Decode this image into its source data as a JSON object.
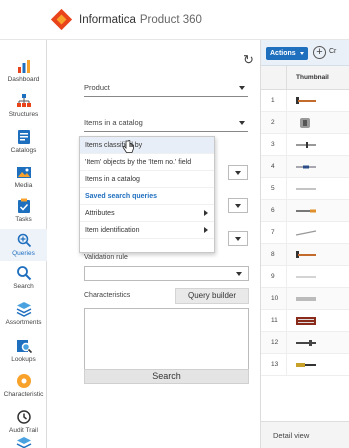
{
  "header": {
    "brand": "Informatica",
    "product": "Product 360"
  },
  "sidebar": {
    "items": [
      {
        "label": "Dashboard",
        "icon": "dashboard-icon"
      },
      {
        "label": "Structures",
        "icon": "structures-icon"
      },
      {
        "label": "Catalogs",
        "icon": "catalogs-icon"
      },
      {
        "label": "Media",
        "icon": "media-icon"
      },
      {
        "label": "Tasks",
        "icon": "tasks-icon"
      },
      {
        "label": "Queries",
        "icon": "queries-icon",
        "active": true
      },
      {
        "label": "Search",
        "icon": "search-icon"
      },
      {
        "label": "Assortments",
        "icon": "assortments-icon"
      },
      {
        "label": "Lookups",
        "icon": "lookups-icon"
      },
      {
        "label": "Characteristic",
        "icon": "characteristic-icon"
      },
      {
        "label": "Audit Trail",
        "icon": "audit-trail-icon"
      }
    ]
  },
  "filters": {
    "product_select": "Product",
    "catalog_select": "Items in a catalog",
    "validation_rule_label": "Validation rule",
    "characteristics_label": "Characteristics",
    "query_builder_button": "Query builder",
    "search_button": "Search"
  },
  "menu": {
    "items": [
      {
        "label": "Items classified by",
        "hover": true
      },
      {
        "label": "'Item' objects by the 'Item no.' field"
      },
      {
        "label": "Items in a catalog"
      },
      {
        "label": "Saved search queries",
        "section": true
      },
      {
        "label": "Attributes",
        "submenu": true
      },
      {
        "label": "Item identification",
        "submenu": true
      }
    ]
  },
  "grid": {
    "actions_label": "Actions",
    "create_label": "Cr",
    "thumbnail_header": "Thumbnail",
    "rows": [
      "1",
      "2",
      "3",
      "4",
      "5",
      "6",
      "7",
      "8",
      "9",
      "10",
      "11",
      "12",
      "13"
    ],
    "detail_view_label": "Detail view"
  },
  "colors": {
    "accent": "#1f6fbf",
    "brand_orange": "#e8431a",
    "brand_yellow": "#f8a22b"
  }
}
